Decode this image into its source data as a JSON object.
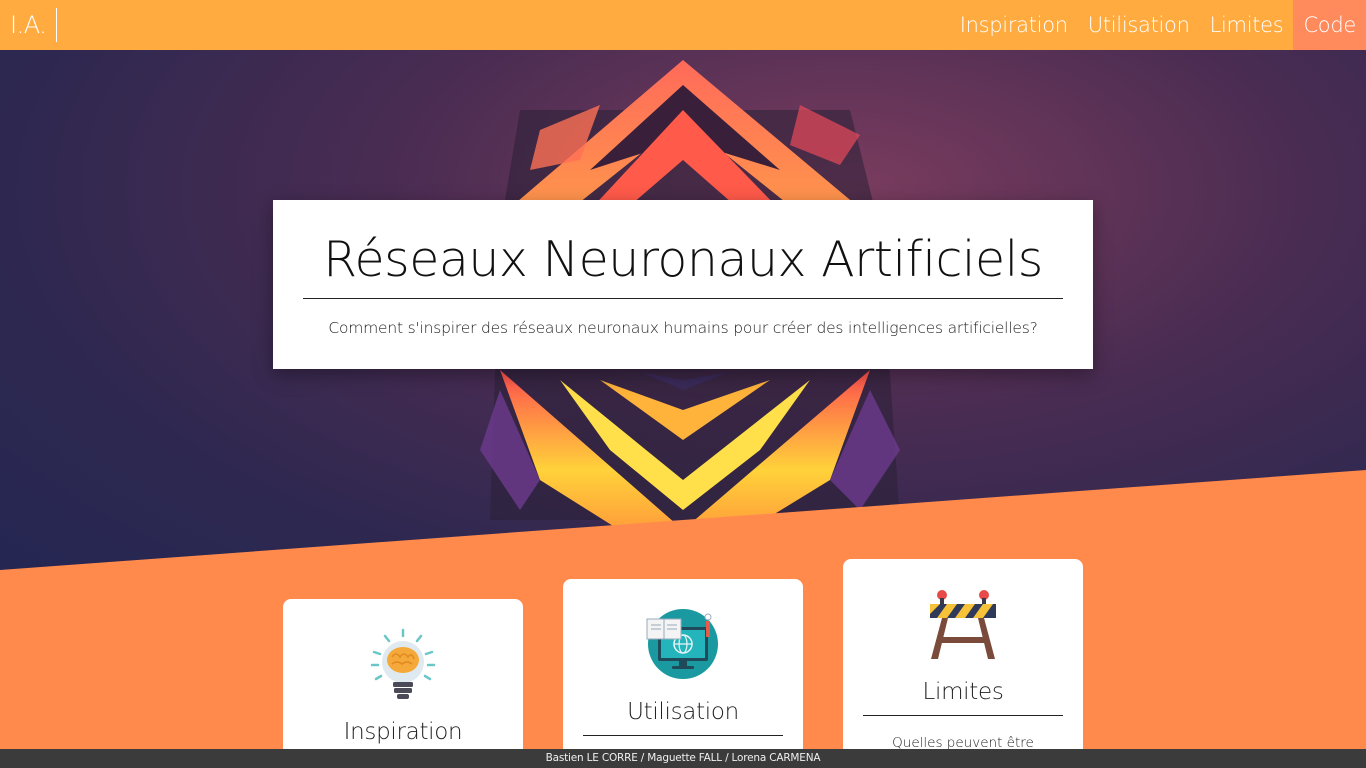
{
  "nav": {
    "brand": "I.A.",
    "links": [
      "Inspiration",
      "Utilisation",
      "Limites",
      "Code"
    ],
    "active": "Code"
  },
  "hero": {
    "title": "Réseaux Neuronaux Artificiels",
    "subtitle": "Comment s'inspirer des réseaux neuronaux humains pour créer des intelligences artificielles?"
  },
  "cards": [
    {
      "title": "Inspiration",
      "icon": "lightbulb-brain-icon"
    },
    {
      "title": "Utilisation",
      "icon": "computer-globe-icon"
    },
    {
      "title": "Limites",
      "icon": "road-barrier-icon",
      "text": "Quelles peuvent être"
    }
  ],
  "footer": {
    "credits": "Bastien LE CORRE / Maguette FALL / Lorena CARMENA"
  },
  "colors": {
    "navbar": "#ffab3f",
    "active_nav": "#ff8a5c",
    "accent": "#ff8a4c",
    "hero_bg": "#2e2850",
    "footer": "#3b3b3b"
  }
}
